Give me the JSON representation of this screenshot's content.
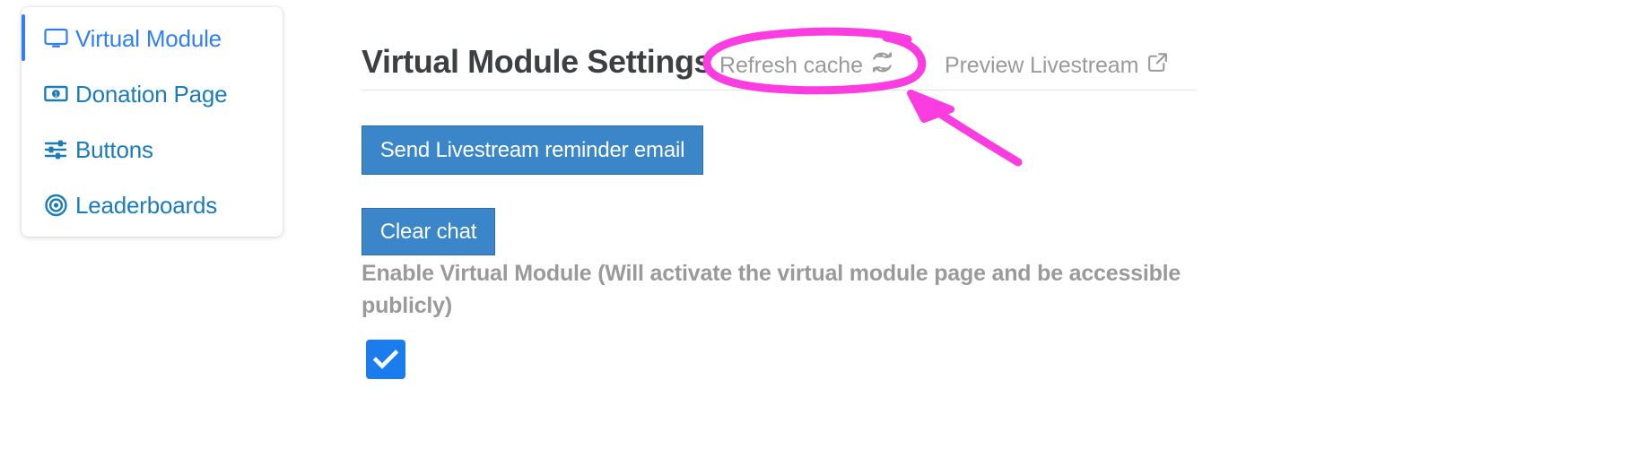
{
  "sidebar": {
    "items": [
      {
        "label": "Virtual Module",
        "icon": "monitor-icon",
        "active": true
      },
      {
        "label": "Donation Page",
        "icon": "banknote-icon",
        "active": false
      },
      {
        "label": "Buttons",
        "icon": "sliders-icon",
        "active": false
      },
      {
        "label": "Leaderboards",
        "icon": "target-icon",
        "active": false
      }
    ]
  },
  "header": {
    "title": "Virtual Module Settings",
    "refresh_cache_label": "Refresh cache",
    "refresh_cache_icon": "sync-icon",
    "preview_livestream_label": "Preview Livestream",
    "preview_livestream_icon": "external-link-icon"
  },
  "actions": {
    "send_reminder_label": "Send Livestream reminder email",
    "clear_chat_label": "Clear chat"
  },
  "settings": {
    "enable_virtual_module_label": "Enable Virtual Module (Will activate the virtual module page and be accessible publicly)",
    "enable_virtual_module_checked": true
  },
  "annotation": {
    "color": "#fa3ce0",
    "shapes": [
      "ellipse-highlight",
      "arrow-pointer"
    ],
    "targets": "Refresh cache"
  },
  "colors": {
    "accent_blue": "#2f7ff5",
    "link_blue": "#1b7cb8",
    "button_blue": "#3a86c8",
    "checkbox_blue": "#1b7ced",
    "muted_gray": "#9a9a9a",
    "title_gray": "#3c4043",
    "annotation_magenta": "#fa3ce0"
  }
}
